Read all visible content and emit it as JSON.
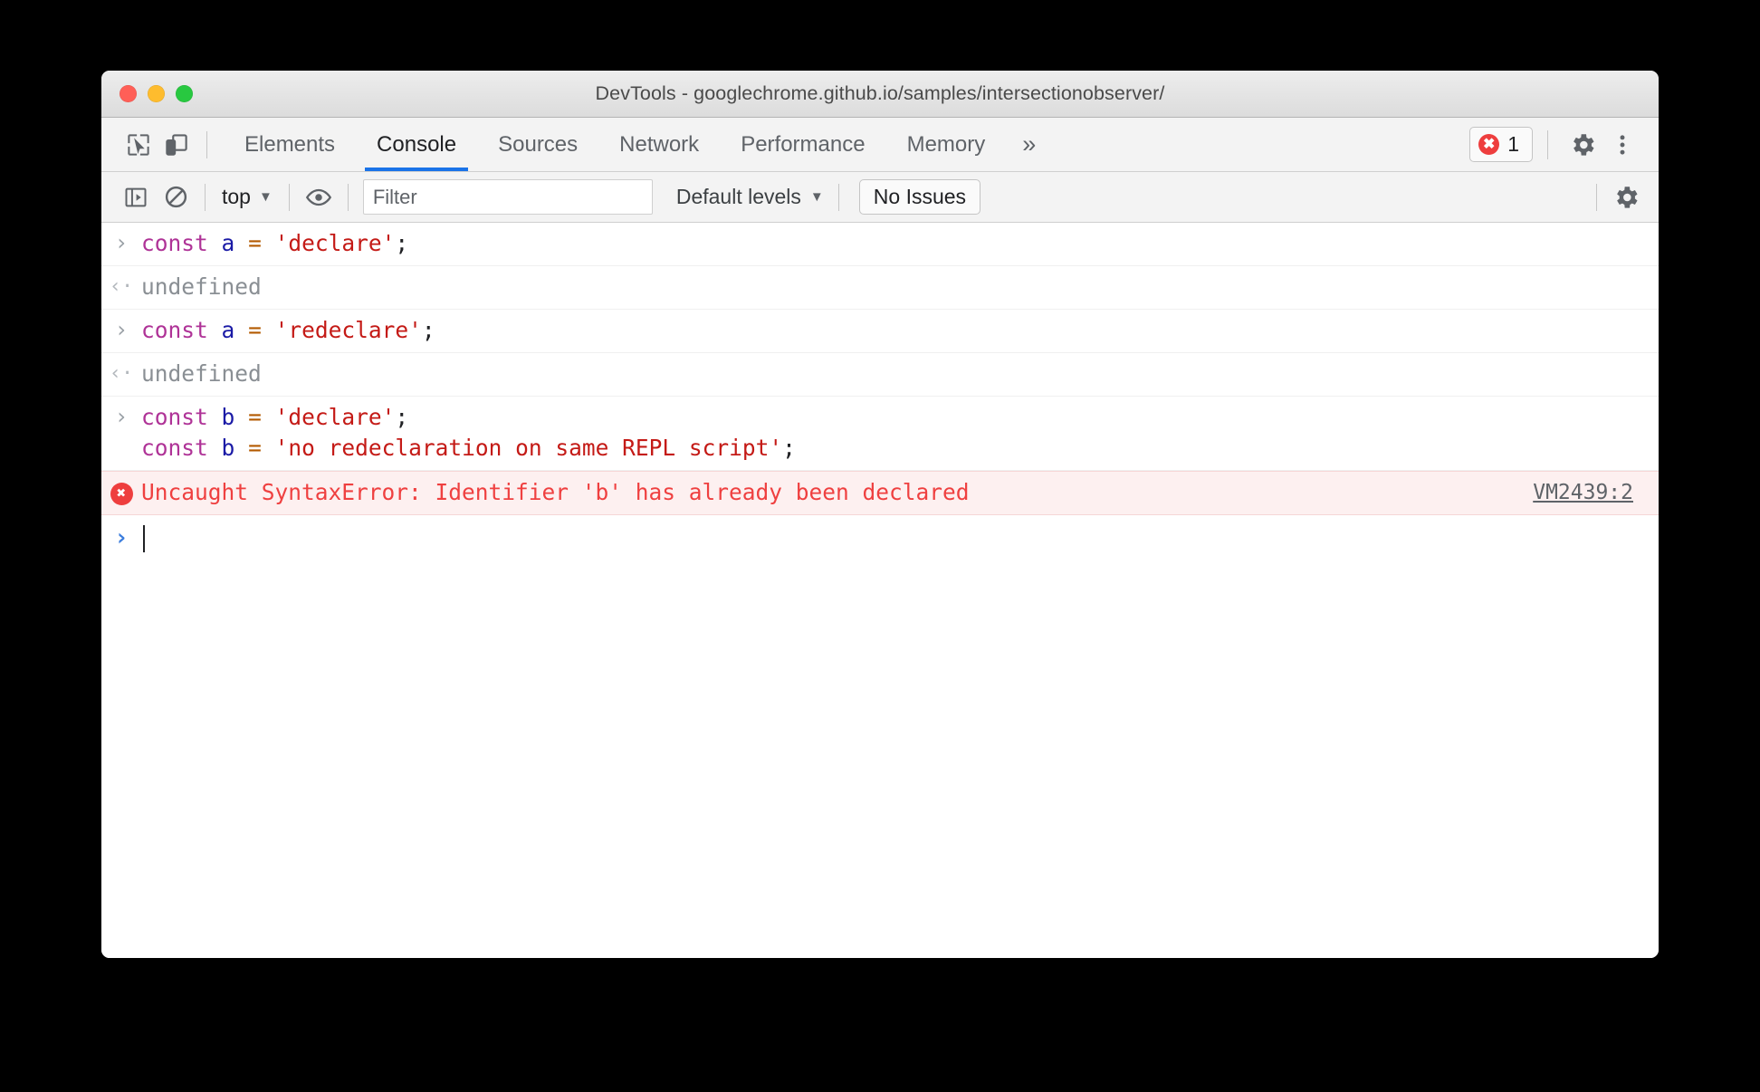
{
  "window": {
    "title": "DevTools - googlechrome.github.io/samples/intersectionobserver/",
    "traffic_lights": [
      "close",
      "minimize",
      "maximize"
    ],
    "accent": "#1a73e8",
    "error_color": "#ee3e3e"
  },
  "tabstrip": {
    "inspect_icon": "inspect-cursor-icon",
    "device_icon": "device-toolbar-icon",
    "tabs": [
      {
        "label": "Elements",
        "active": false
      },
      {
        "label": "Console",
        "active": true
      },
      {
        "label": "Sources",
        "active": false
      },
      {
        "label": "Network",
        "active": false
      },
      {
        "label": "Performance",
        "active": false
      },
      {
        "label": "Memory",
        "active": false
      }
    ],
    "more_tabs_label": "»",
    "error_count": "1",
    "settings_icon": "gear-icon",
    "menu_icon": "kebab-menu-icon"
  },
  "console_toolbar": {
    "sidebar_toggle_icon": "console-sidebar-icon",
    "clear_icon": "clear-console-icon",
    "context": "top",
    "context_caret": "▼",
    "eye_icon": "live-expression-icon",
    "filter_placeholder": "Filter",
    "filter_value": "",
    "levels_label": "Default levels",
    "levels_caret": "▼",
    "issues_label": "No Issues",
    "settings_icon": "gear-icon"
  },
  "console": {
    "input_marker": "›",
    "output_marker": "‹·",
    "entries": [
      {
        "kind": "input",
        "lines": [
          [
            {
              "t": "const",
              "c": "kw"
            },
            {
              "t": " ",
              "c": "pun"
            },
            {
              "t": "a",
              "c": "id"
            },
            {
              "t": " ",
              "c": "pun"
            },
            {
              "t": "=",
              "c": "op"
            },
            {
              "t": " ",
              "c": "pun"
            },
            {
              "t": "'declare'",
              "c": "str"
            },
            {
              "t": ";",
              "c": "pun"
            }
          ]
        ]
      },
      {
        "kind": "output",
        "text": "undefined"
      },
      {
        "kind": "input",
        "lines": [
          [
            {
              "t": "const",
              "c": "kw"
            },
            {
              "t": " ",
              "c": "pun"
            },
            {
              "t": "a",
              "c": "id"
            },
            {
              "t": " ",
              "c": "pun"
            },
            {
              "t": "=",
              "c": "op"
            },
            {
              "t": " ",
              "c": "pun"
            },
            {
              "t": "'redeclare'",
              "c": "str"
            },
            {
              "t": ";",
              "c": "pun"
            }
          ]
        ]
      },
      {
        "kind": "output",
        "text": "undefined"
      },
      {
        "kind": "input",
        "lines": [
          [
            {
              "t": "const",
              "c": "kw"
            },
            {
              "t": " ",
              "c": "pun"
            },
            {
              "t": "b",
              "c": "id"
            },
            {
              "t": " ",
              "c": "pun"
            },
            {
              "t": "=",
              "c": "op"
            },
            {
              "t": " ",
              "c": "pun"
            },
            {
              "t": "'declare'",
              "c": "str"
            },
            {
              "t": ";",
              "c": "pun"
            }
          ],
          [
            {
              "t": "const",
              "c": "kw"
            },
            {
              "t": " ",
              "c": "pun"
            },
            {
              "t": "b",
              "c": "id"
            },
            {
              "t": " ",
              "c": "pun"
            },
            {
              "t": "=",
              "c": "op"
            },
            {
              "t": " ",
              "c": "pun"
            },
            {
              "t": "'no redeclaration on same REPL script'",
              "c": "str"
            },
            {
              "t": ";",
              "c": "pun"
            }
          ]
        ]
      },
      {
        "kind": "error",
        "text": "Uncaught SyntaxError: Identifier 'b' has already been declared",
        "link": "VM2439:2"
      },
      {
        "kind": "prompt",
        "value": ""
      }
    ]
  }
}
